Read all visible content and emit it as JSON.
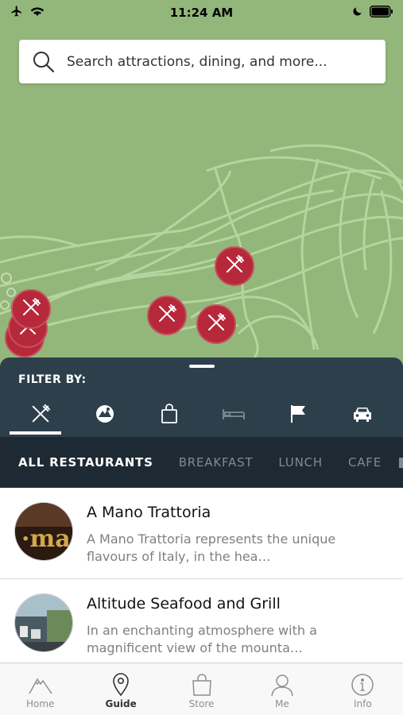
{
  "status_bar": {
    "time": "11:24 AM",
    "icons": [
      "airplane-icon",
      "wifi-icon",
      "moon-icon",
      "battery-icon"
    ]
  },
  "search": {
    "placeholder": "Search attractions, dining, and more..."
  },
  "map": {
    "background_color": "#93b77a",
    "trail_color": "#b8d6a3",
    "pin_color": "#b6283a",
    "pin_icon": "fork-knife-icon"
  },
  "filter_panel": {
    "label": "FILTER BY:",
    "icons": [
      "fork-knife-icon",
      "ski-resort-icon",
      "shopping-bag-icon",
      "bed-icon",
      "flag-icon",
      "car-icon"
    ],
    "active_index": 0
  },
  "category_tabs": [
    {
      "label": "ALL RESTAURANTS",
      "active": true
    },
    {
      "label": "BREAKFAST",
      "active": false
    },
    {
      "label": "LUNCH",
      "active": false
    },
    {
      "label": "CAFE",
      "active": false
    }
  ],
  "restaurants": [
    {
      "name": "A Mano Trattoria",
      "description": "A Mano Trattoria represents the unique flavours of Italy, in the hea…"
    },
    {
      "name": "Altitude Seafood and Grill",
      "description": "In an enchanting atmosphere with a magnificent view of the mounta…"
    }
  ],
  "tab_bar": [
    {
      "label": "Home",
      "icon": "mountain-icon",
      "active": false
    },
    {
      "label": "Guide",
      "icon": "map-pin-icon",
      "active": true
    },
    {
      "label": "Store",
      "icon": "shopping-bag-icon",
      "active": false
    },
    {
      "label": "Me",
      "icon": "person-icon",
      "active": false
    },
    {
      "label": "Info",
      "icon": "info-icon",
      "active": false
    }
  ]
}
